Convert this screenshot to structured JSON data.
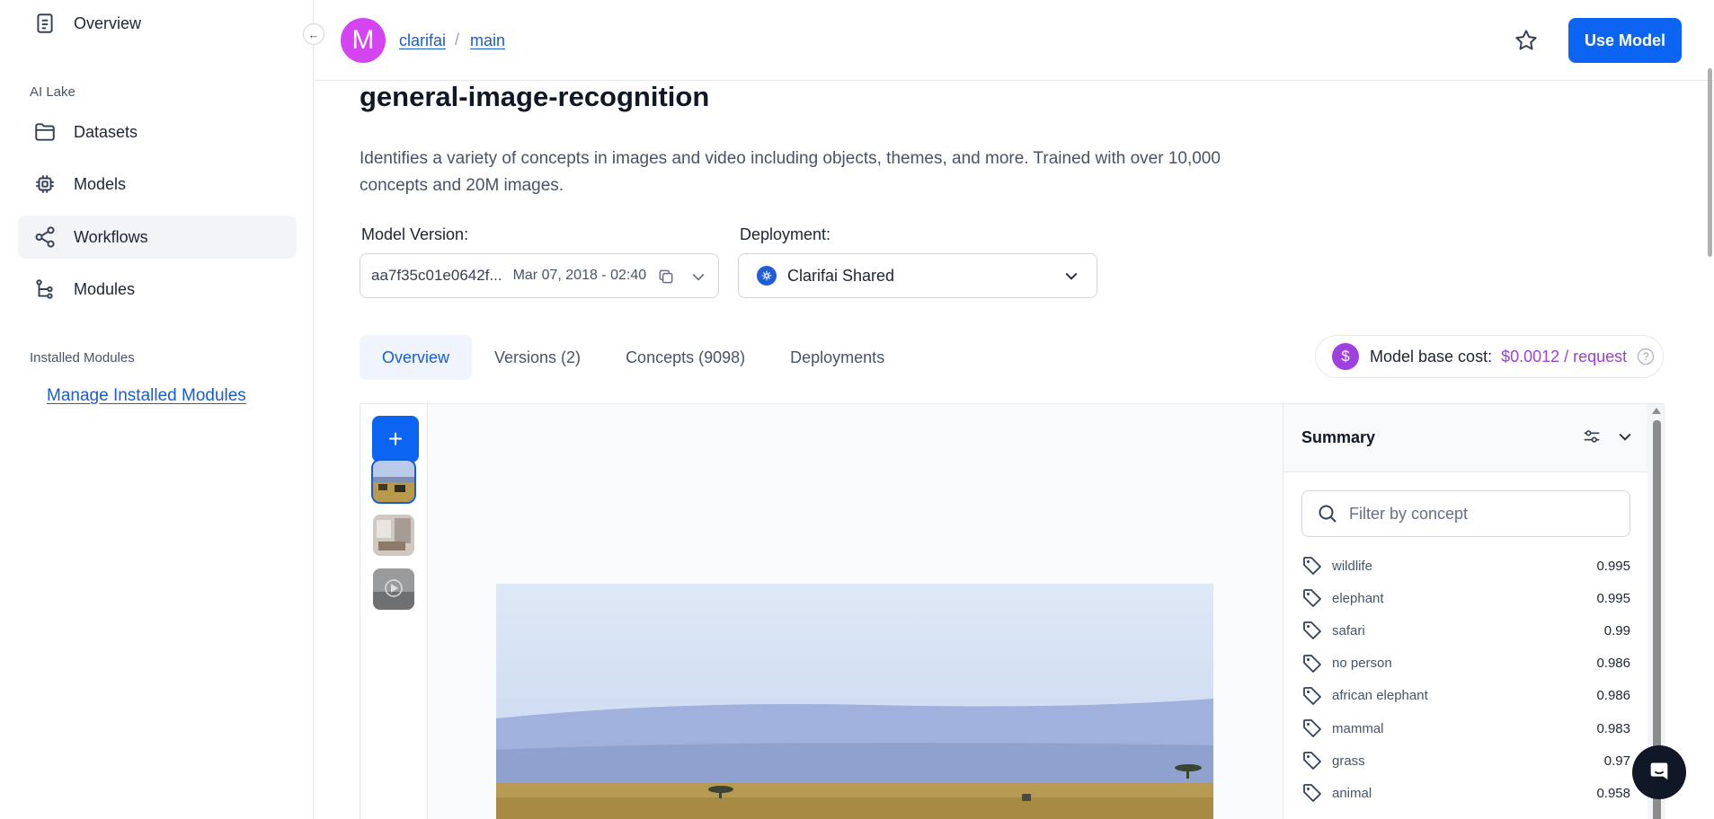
{
  "sidebar": {
    "items": [
      {
        "label": "Overview",
        "icon": "document-icon"
      },
      {
        "label": "Datasets",
        "icon": "folder-icon"
      },
      {
        "label": "Models",
        "icon": "chip-icon"
      },
      {
        "label": "Workflows",
        "icon": "share-nodes-icon"
      },
      {
        "label": "Modules",
        "icon": "hierarchy-icon"
      }
    ],
    "section_ai_lake": "AI Lake",
    "section_installed": "Installed Modules",
    "manage_link": "Manage Installed Modules",
    "collapse_icon": "←"
  },
  "header": {
    "avatar_letter": "M",
    "breadcrumb_user": "clarifai",
    "breadcrumb_separator": "/",
    "breadcrumb_app": "main",
    "use_model_label": "Use Model"
  },
  "model": {
    "title": "general-image-recognition",
    "description": "Identifies a variety of concepts in images and video including objects, themes, and more. Trained with over 10,000 concepts and 20M images.",
    "version_label": "Model Version:",
    "version_id": "aa7f35c01e0642f...",
    "version_date": "Mar 07, 2018 - 02:40",
    "deployment_label": "Deployment:",
    "deployment_value": "Clarifai Shared"
  },
  "tabs": [
    {
      "label": "Overview",
      "active": true
    },
    {
      "label": "Versions (2)",
      "active": false
    },
    {
      "label": "Concepts (9098)",
      "active": false
    },
    {
      "label": "Deployments",
      "active": false
    }
  ],
  "cost": {
    "icon": "$",
    "label": "Model base cost:",
    "value": "$0.0012 / request",
    "help": "?"
  },
  "workspace": {
    "add_label": "+"
  },
  "summary": {
    "title": "Summary",
    "filter_placeholder": "Filter by concept",
    "concepts": [
      {
        "name": "wildlife",
        "value": "0.995"
      },
      {
        "name": "elephant",
        "value": "0.995"
      },
      {
        "name": "safari",
        "value": "0.99"
      },
      {
        "name": "no person",
        "value": "0.986"
      },
      {
        "name": "african elephant",
        "value": "0.986"
      },
      {
        "name": "mammal",
        "value": "0.983"
      },
      {
        "name": "grass",
        "value": "0.97"
      },
      {
        "name": "animal",
        "value": "0.958"
      }
    ]
  },
  "colors": {
    "primary": "#0b65f2",
    "link": "#175cd3",
    "avatar": "#d444f1",
    "cost_accent": "#9e3fe0"
  }
}
